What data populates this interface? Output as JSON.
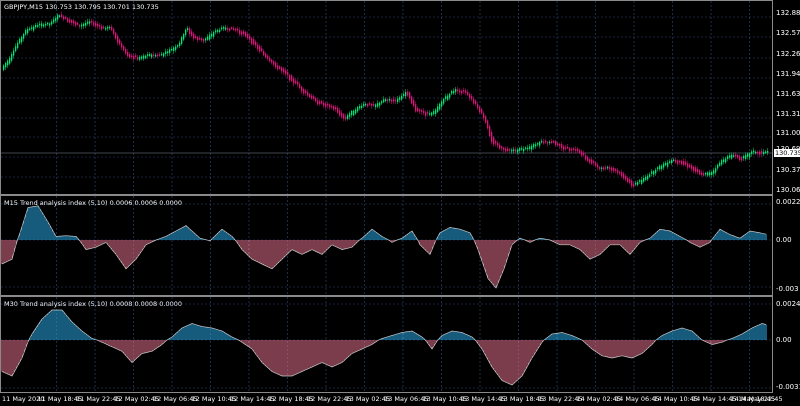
{
  "main": {
    "title": "GBPJPY,M15  130.753 130.795 130.701 130.735",
    "price_labels": [
      "132.885",
      "132.570",
      "132.260",
      "131.945",
      "131.630",
      "131.315",
      "131.005",
      "130.690",
      "130.375",
      "130.060"
    ],
    "current_price": "130.735"
  },
  "ind1": {
    "title": "M15 Trend analysis index (5,10) 0.0006 0.0006 0.0000",
    "labels": [
      "0.0022",
      "0.00",
      "-0.003"
    ]
  },
  "ind2": {
    "title": "M30 Trend analysis index (5,10) 0.0008 0.0008 0.0000",
    "labels": [
      "0.0024",
      "0.00",
      "-0.0031"
    ]
  },
  "time_labels": [
    "11 May 2020",
    "11 May 18:45",
    "11 May 22:45",
    "12 May 02:45",
    "12 May 06:45",
    "12 May 10:45",
    "12 May 14:45",
    "12 May 18:45",
    "12 May 22:45",
    "13 May 02:45",
    "13 May 06:45",
    "13 May 10:45",
    "13 May 14:45",
    "13 May 18:45",
    "13 May 22:45",
    "14 May 02:45",
    "14 May 06:45",
    "14 May 10:45",
    "14 May 14:45",
    "14 May 18:45",
    "14 May 22:45"
  ],
  "colors": {
    "bull": "#00e676",
    "bear": "#e0127c",
    "pos": "#29a6e0",
    "neg": "#e06f8a",
    "grid": "#2d4b7a",
    "bg": "#000000"
  }
}
